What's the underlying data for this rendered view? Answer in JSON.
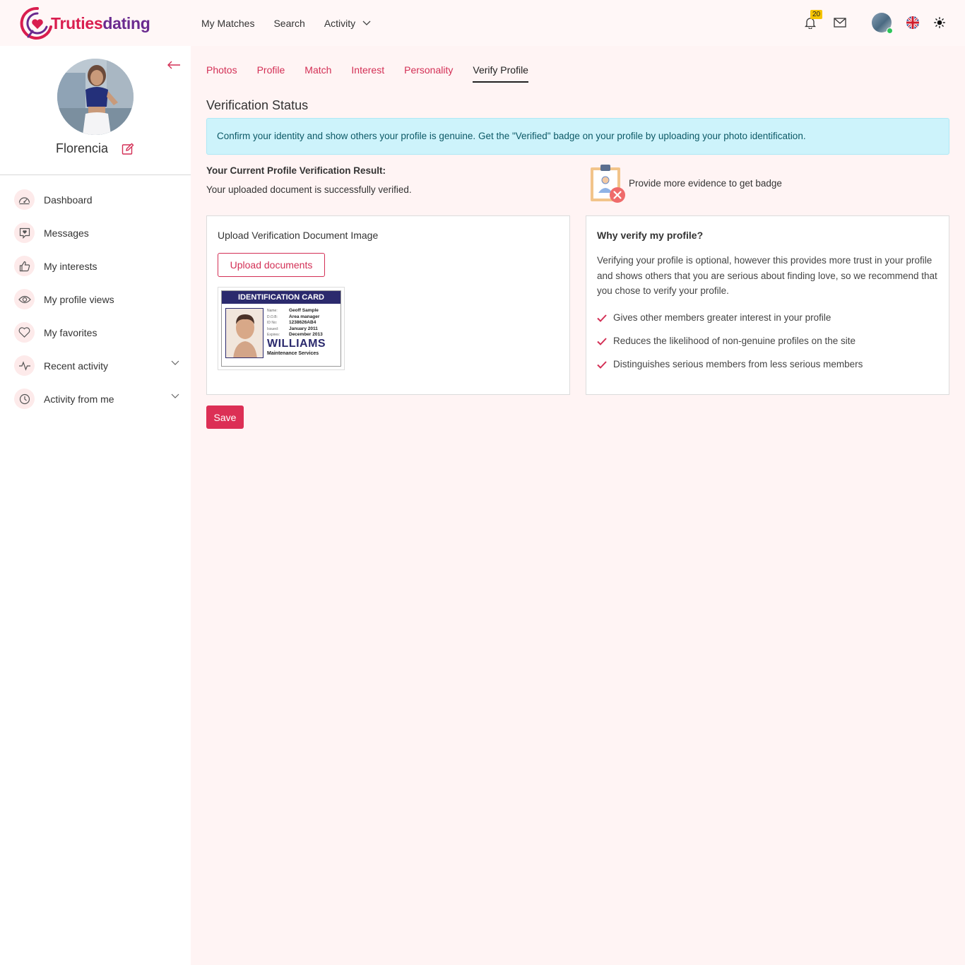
{
  "brand": {
    "part1": "Truties",
    "part2": "dating"
  },
  "topnav": {
    "my_matches": "My Matches",
    "search": "Search",
    "activity": "Activity"
  },
  "notifications": {
    "count": "20"
  },
  "sidebar": {
    "name": "Florencia",
    "items": [
      {
        "label": "Dashboard",
        "icon": "dashboard-icon"
      },
      {
        "label": "Messages",
        "icon": "message-heart-icon"
      },
      {
        "label": "My interests",
        "icon": "thumbs-up-icon"
      },
      {
        "label": "My profile views",
        "icon": "eye-icon"
      },
      {
        "label": "My favorites",
        "icon": "heart-icon"
      },
      {
        "label": "Recent activity",
        "icon": "activity-icon"
      },
      {
        "label": "Activity from me",
        "icon": "clock-icon"
      }
    ]
  },
  "tabs": [
    "Photos",
    "Profile",
    "Match",
    "Interest",
    "Personality",
    "Verify Profile"
  ],
  "active_tab": "Verify Profile",
  "verification": {
    "title": "Verification Status",
    "alert": "Confirm your identity and show others your profile is genuine. Get the \"Verified\" badge on your profile by uploading your photo identification.",
    "result_title": "Your Current Profile Verification Result:",
    "result_text": "Your uploaded document is successfully verified.",
    "badge_text": "Provide more evidence to get badge"
  },
  "upload_card": {
    "title": "Upload Verification Document Image",
    "button": "Upload documents",
    "id_card": {
      "header": "IDENTIFICATION CARD",
      "rows": [
        {
          "k": "Name:",
          "v": "Geoff Sample"
        },
        {
          "k": "D.O.B:",
          "v": "Area manager"
        },
        {
          "k": "ID No:",
          "v": "1238626AB4"
        },
        {
          "k": "Issued:",
          "v": "January 2011"
        },
        {
          "k": "Expires:",
          "v": "December 2013"
        }
      ],
      "brand": "WILLIAMS",
      "sub": "Maintenance Services"
    }
  },
  "why_card": {
    "title": "Why verify my profile?",
    "text": "Verifying your profile is optional, however this provides more trust in your profile and shows others that you are serious about finding love, so we recommend that you chose to verify your profile.",
    "points": [
      "Gives other members greater interest in your profile",
      "Reduces the likelihood of non-genuine profiles on the site",
      "Distinguishes serious members from less serious members"
    ]
  },
  "save_label": "Save",
  "colors": {
    "accent": "#dc2f55",
    "brand_purple": "#6a2a8f",
    "alert_bg": "#cdf3fb",
    "page_bg": "#fff4f4"
  }
}
